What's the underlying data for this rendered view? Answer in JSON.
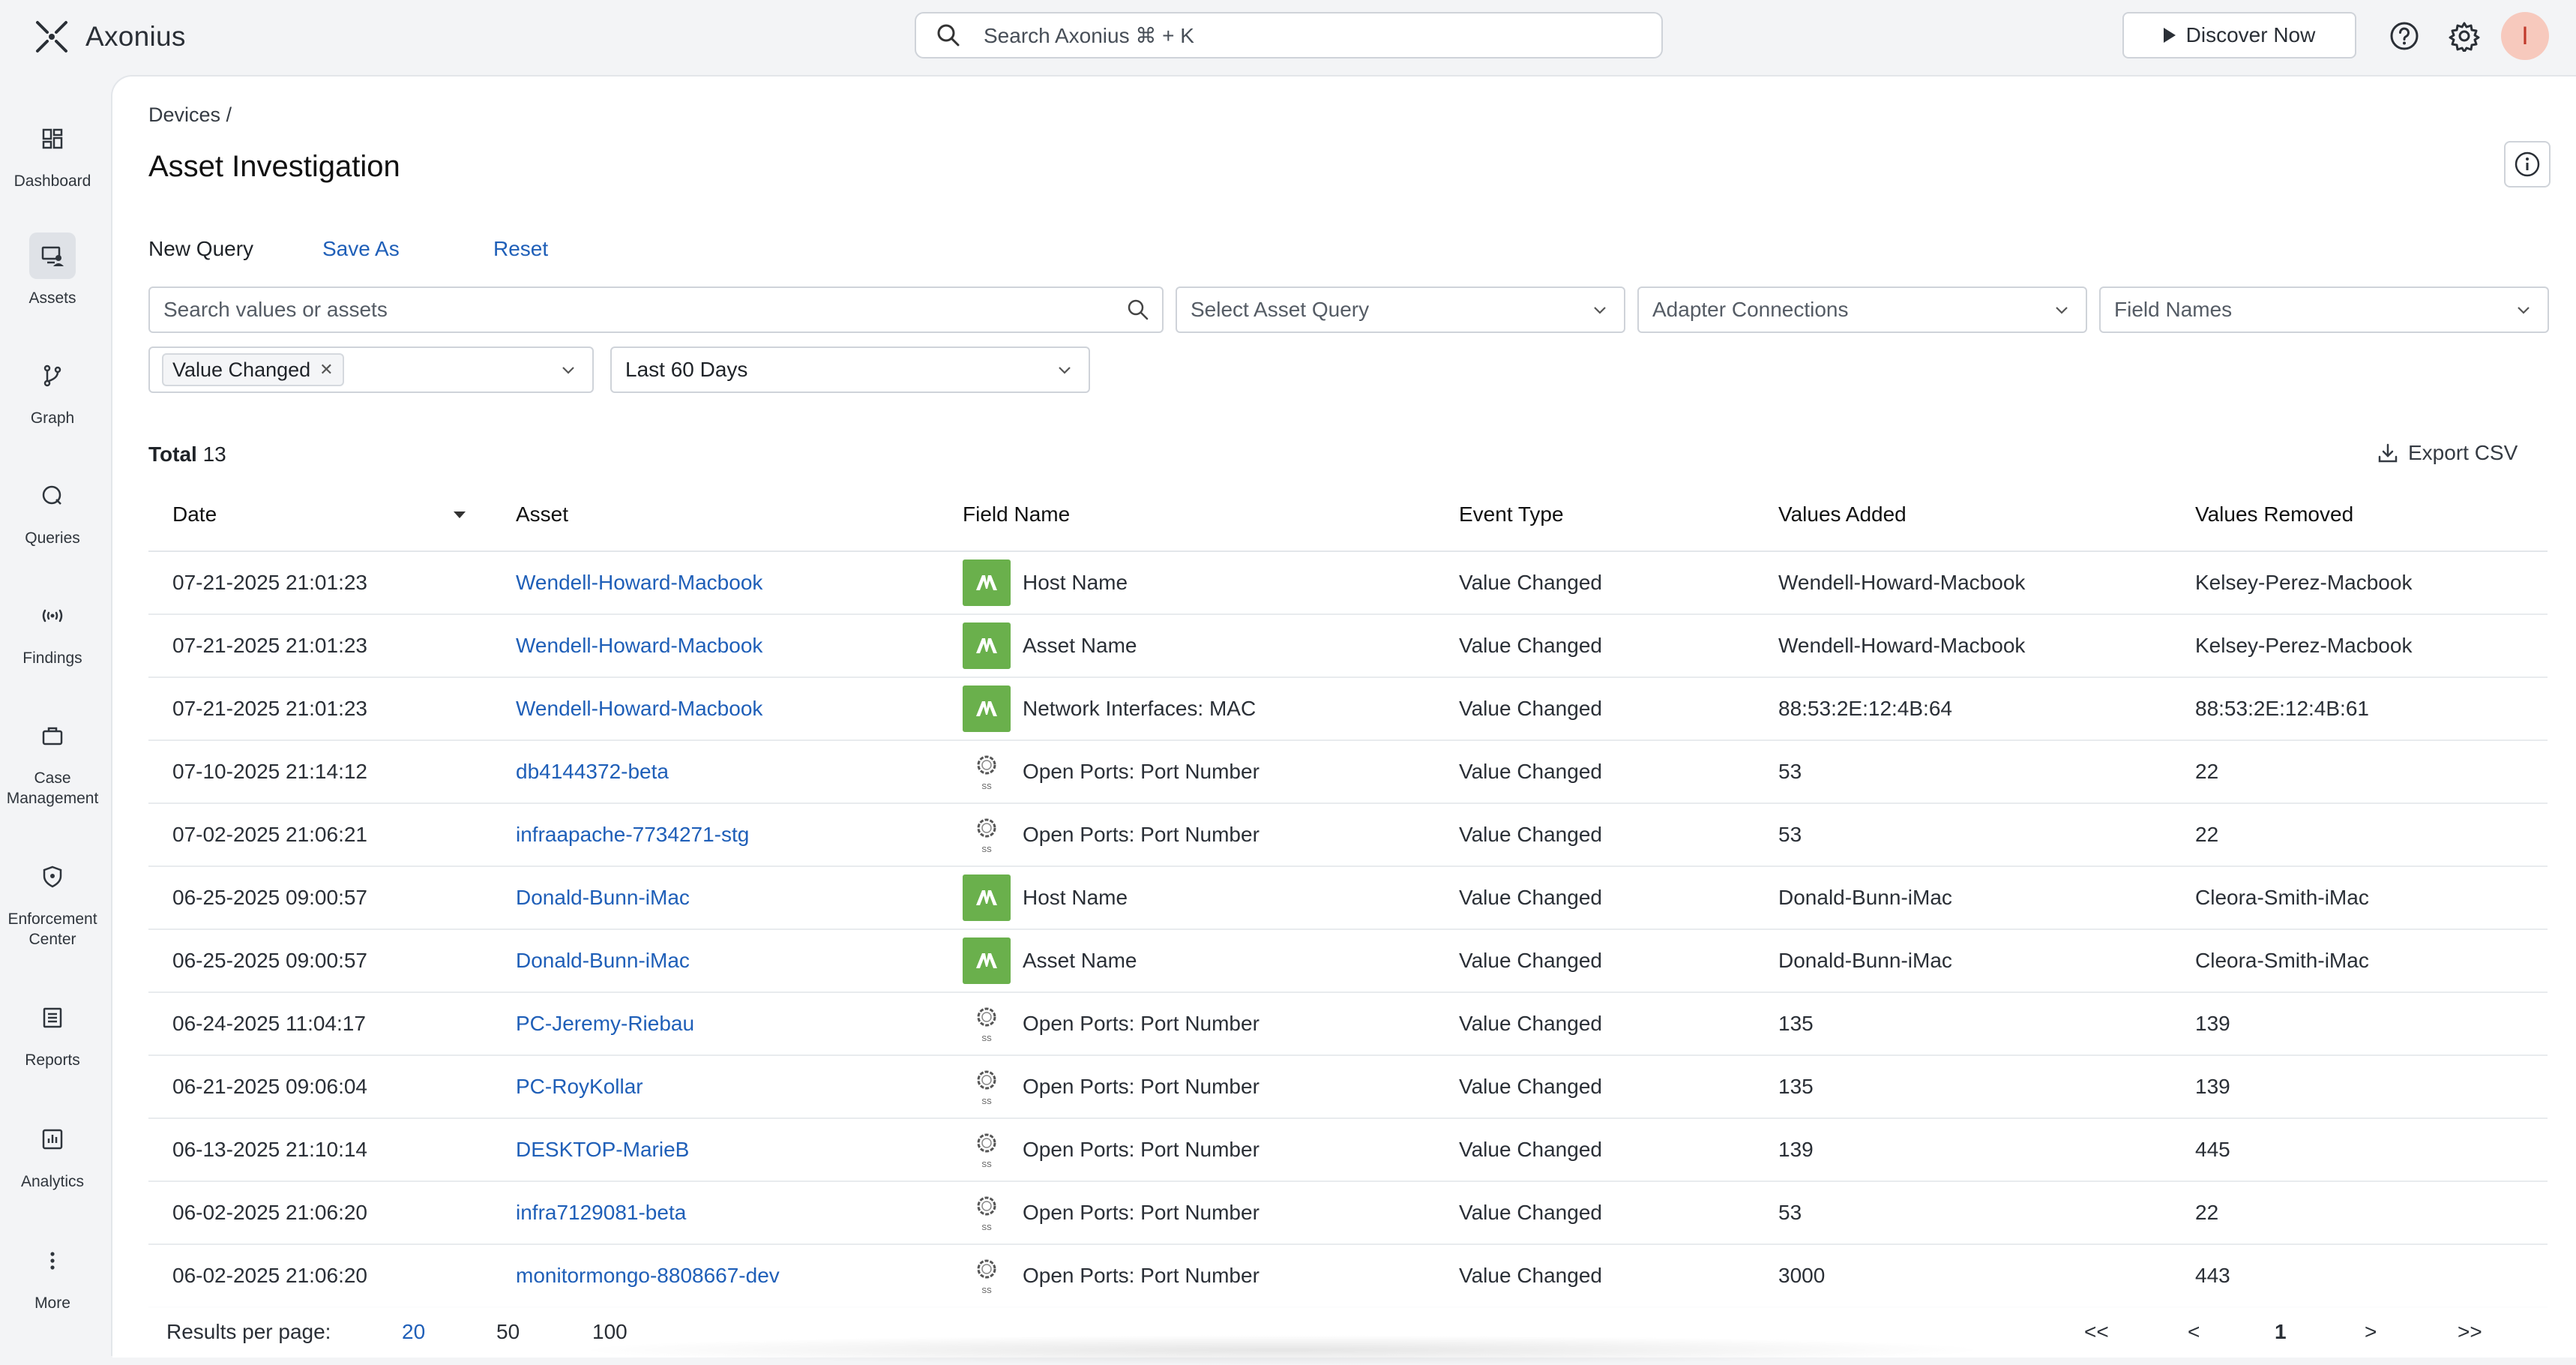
{
  "app": {
    "name": "Axonius"
  },
  "header": {
    "search_placeholder": "Search Axonius ⌘ + K",
    "discover_label": "Discover Now",
    "avatar_initial": "I",
    "help_icon": "question-circle-icon",
    "settings_icon": "gear-icon",
    "avatar_color": "#f7c9bd"
  },
  "nav": {
    "items": [
      {
        "label": "Dashboard",
        "icon": "dashboard-icon"
      },
      {
        "label": "Assets",
        "icon": "assets-icon",
        "active": true
      },
      {
        "label": "Graph",
        "icon": "graph-icon"
      },
      {
        "label": "Queries",
        "icon": "queries-icon"
      },
      {
        "label": "Findings",
        "icon": "findings-icon"
      },
      {
        "label": "Case Management",
        "icon": "briefcase-icon"
      },
      {
        "label": "Enforcement Center",
        "icon": "shield-icon"
      },
      {
        "label": "Reports",
        "icon": "reports-icon"
      },
      {
        "label": "Analytics",
        "icon": "analytics-icon"
      },
      {
        "label": "More",
        "icon": "more-vertical-icon"
      }
    ]
  },
  "page": {
    "breadcrumb": "Devices /",
    "title": "Asset Investigation"
  },
  "query_actions": {
    "new_query": "New Query",
    "save_as": "Save As",
    "reset": "Reset"
  },
  "filters": {
    "search_placeholder": "Search values or assets",
    "asset_query_placeholder": "Select Asset Query",
    "adapter_connections_placeholder": "Adapter Connections",
    "field_names_placeholder": "Field Names",
    "event_type_chip": "Value Changed",
    "date_range": "Last 60 Days"
  },
  "summary": {
    "total_label": "Total",
    "total_value": "13",
    "export_label": "Export CSV"
  },
  "table": {
    "columns": [
      "Date",
      "Asset",
      "Field Name",
      "Event Type",
      "Values Added",
      "Values Removed"
    ],
    "sort_column": "Date",
    "rows": [
      {
        "date": "07-21-2025 21:01:23",
        "asset": "Wendell-Howard-Macbook",
        "adapter": "green",
        "field": "Host Name",
        "event": "Value Changed",
        "added": "Wendell-Howard-Macbook",
        "removed": "Kelsey-Perez-Macbook"
      },
      {
        "date": "07-21-2025 21:01:23",
        "asset": "Wendell-Howard-Macbook",
        "adapter": "green",
        "field": "Asset Name",
        "event": "Value Changed",
        "added": "Wendell-Howard-Macbook",
        "removed": "Kelsey-Perez-Macbook"
      },
      {
        "date": "07-21-2025 21:01:23",
        "asset": "Wendell-Howard-Macbook",
        "adapter": "green",
        "field": "Network Interfaces: MAC",
        "event": "Value Changed",
        "added": "88:53:2E:12:4B:64",
        "removed": "88:53:2E:12:4B:61"
      },
      {
        "date": "07-10-2025 21:14:12",
        "asset": "db4144372-beta",
        "adapter": "ss",
        "field": "Open Ports: Port Number",
        "event": "Value Changed",
        "added": "53",
        "removed": "22"
      },
      {
        "date": "07-02-2025 21:06:21",
        "asset": "infraapache-7734271-stg",
        "adapter": "ss",
        "field": "Open Ports: Port Number",
        "event": "Value Changed",
        "added": "53",
        "removed": "22"
      },
      {
        "date": "06-25-2025 09:00:57",
        "asset": "Donald-Bunn-iMac",
        "adapter": "green",
        "field": "Host Name",
        "event": "Value Changed",
        "added": "Donald-Bunn-iMac",
        "removed": "Cleora-Smith-iMac"
      },
      {
        "date": "06-25-2025 09:00:57",
        "asset": "Donald-Bunn-iMac",
        "adapter": "green",
        "field": "Asset Name",
        "event": "Value Changed",
        "added": "Donald-Bunn-iMac",
        "removed": "Cleora-Smith-iMac"
      },
      {
        "date": "06-24-2025 11:04:17",
        "asset": "PC-Jeremy-Riebau",
        "adapter": "ss",
        "field": "Open Ports: Port Number",
        "event": "Value Changed",
        "added": "135",
        "removed": "139"
      },
      {
        "date": "06-21-2025 09:06:04",
        "asset": "PC-RoyKollar",
        "adapter": "ss",
        "field": "Open Ports: Port Number",
        "event": "Value Changed",
        "added": "135",
        "removed": "139"
      },
      {
        "date": "06-13-2025 21:10:14",
        "asset": "DESKTOP-MarieB",
        "adapter": "ss",
        "field": "Open Ports: Port Number",
        "event": "Value Changed",
        "added": "139",
        "removed": "445"
      },
      {
        "date": "06-02-2025 21:06:20",
        "asset": "infra7129081-beta",
        "adapter": "ss",
        "field": "Open Ports: Port Number",
        "event": "Value Changed",
        "added": "53",
        "removed": "22"
      },
      {
        "date": "06-02-2025 21:06:20",
        "asset": "monitormongo-8808667-dev",
        "adapter": "ss",
        "field": "Open Ports: Port Number",
        "event": "Value Changed",
        "added": "3000",
        "removed": "443"
      }
    ]
  },
  "pagination": {
    "results_label": "Results per page:",
    "page_sizes": [
      "20",
      "50",
      "100"
    ],
    "selected_page_size": "20",
    "first": "<<",
    "prev": "<",
    "current": "1",
    "next": ">",
    "last": ">>"
  },
  "colors": {
    "accent_link": "#1f5fb8",
    "adapter_green": "#6ab04c"
  }
}
